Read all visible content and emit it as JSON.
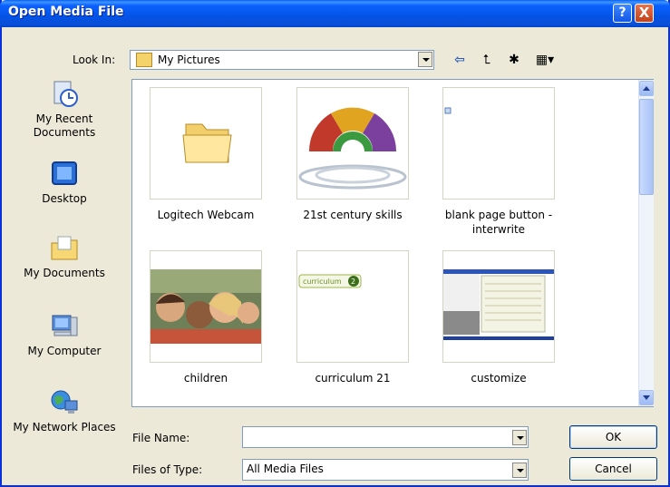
{
  "window": {
    "title": "Open Media File"
  },
  "titlebar_buttons": {
    "help": "?",
    "close": "X"
  },
  "look_in": {
    "label": "Look In:",
    "value": "My Pictures"
  },
  "toolbar": {
    "back": "⇦",
    "up": "⮤",
    "new_folder": "✱",
    "view": "▦▾"
  },
  "places": [
    {
      "label": "My Recent Documents",
      "icon": "recent-documents-icon"
    },
    {
      "label": "Desktop",
      "icon": "desktop-icon"
    },
    {
      "label": "My Documents",
      "icon": "my-documents-icon"
    },
    {
      "label": "My Computer",
      "icon": "my-computer-icon"
    },
    {
      "label": "My Network Places",
      "icon": "network-places-icon"
    }
  ],
  "files": [
    {
      "name": "Logitech Webcam",
      "kind": "folder"
    },
    {
      "name": "21st century skills",
      "kind": "image"
    },
    {
      "name": "blank page button - interwrite",
      "kind": "image"
    },
    {
      "name": "children",
      "kind": "image"
    },
    {
      "name": "curriculum 21",
      "kind": "image",
      "thumb_text": "curriculum"
    },
    {
      "name": "customize",
      "kind": "image"
    }
  ],
  "file_name": {
    "label": "File Name:",
    "value": ""
  },
  "files_of_type": {
    "label": "Files of Type:",
    "value": "All Media Files"
  },
  "buttons": {
    "ok": "OK",
    "cancel": "Cancel"
  },
  "colors": {
    "title_blue": "#0a5ff0",
    "face": "#ece9d8",
    "close_red": "#c24016"
  }
}
